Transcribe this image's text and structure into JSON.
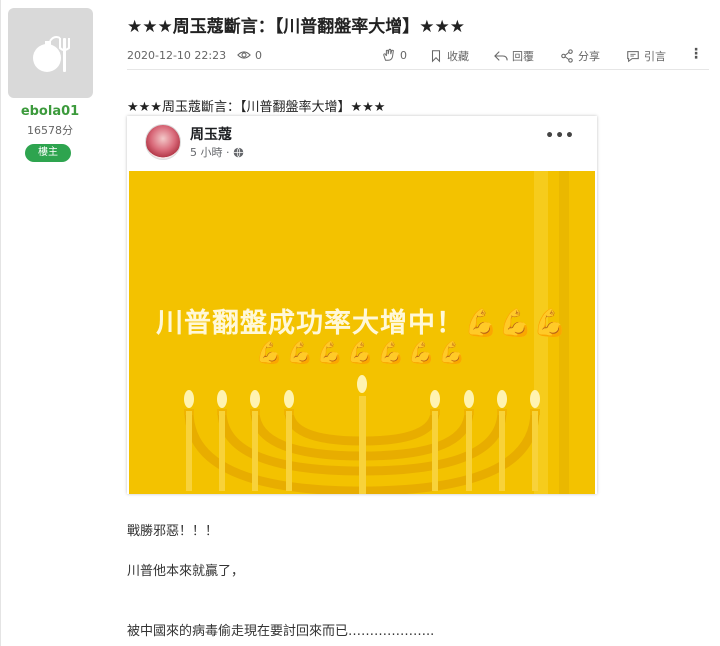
{
  "author": {
    "name": "ebola01",
    "points": "16578分",
    "badge": "樓主"
  },
  "post": {
    "title": "★★★周玉蔻斷言：【川普翻盤率大增】★★★",
    "date": "2020-12-10 22:23",
    "views": "0",
    "likes": "0",
    "favorite_label": "收藏",
    "reply_label": "回覆",
    "share_label": "分享",
    "quote_label": "引言",
    "more_label": "⋮",
    "repeat_title": "★★★周玉蔻斷言：【川普翻盤率大增】★★★",
    "lines": [
      "戰勝邪惡！！！",
      "川普他本來就贏了，",
      "被中國來的病毒偷走現在要討回來而已……………….."
    ]
  },
  "embed": {
    "name": "周玉蔻",
    "time": "5 小時 ·",
    "more_label": "•••",
    "image_headline": "川普翻盤成功率大增中！💪💪💪",
    "image_emojis": "💪💪💪💪💪💪💪"
  },
  "colors": {
    "accent_green": "#2ea44f",
    "author_green": "#3c9a3c",
    "image_yellow": "#f3c200"
  }
}
